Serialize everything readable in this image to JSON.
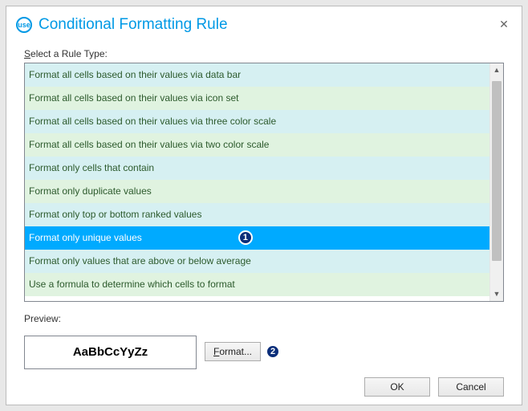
{
  "dialog": {
    "title": "Conditional Formatting Rule",
    "app_icon_text": "use"
  },
  "labels": {
    "select_rule_type_prefix": "S",
    "select_rule_type_rest": "elect a Rule Type:",
    "preview": "Preview:"
  },
  "rule_types": [
    "Format all cells based on their values via data bar",
    "Format all cells based on their values via icon set",
    "Format all cells based on their values via three color scale",
    "Format all cells based on their values via two color scale",
    "Format only cells that contain",
    "Format only duplicate values",
    "Format only top or bottom ranked values",
    "Format only unique values",
    "Format only values that are above or below average",
    "Use a formula to determine which cells to format"
  ],
  "selected_index": 7,
  "callouts": {
    "rule_badge": "1",
    "format_badge": "2"
  },
  "preview": {
    "sample_text": "AaBbCcYyZz"
  },
  "buttons": {
    "format_prefix": "F",
    "format_rest": "ormat...",
    "ok": "OK",
    "cancel": "Cancel"
  }
}
